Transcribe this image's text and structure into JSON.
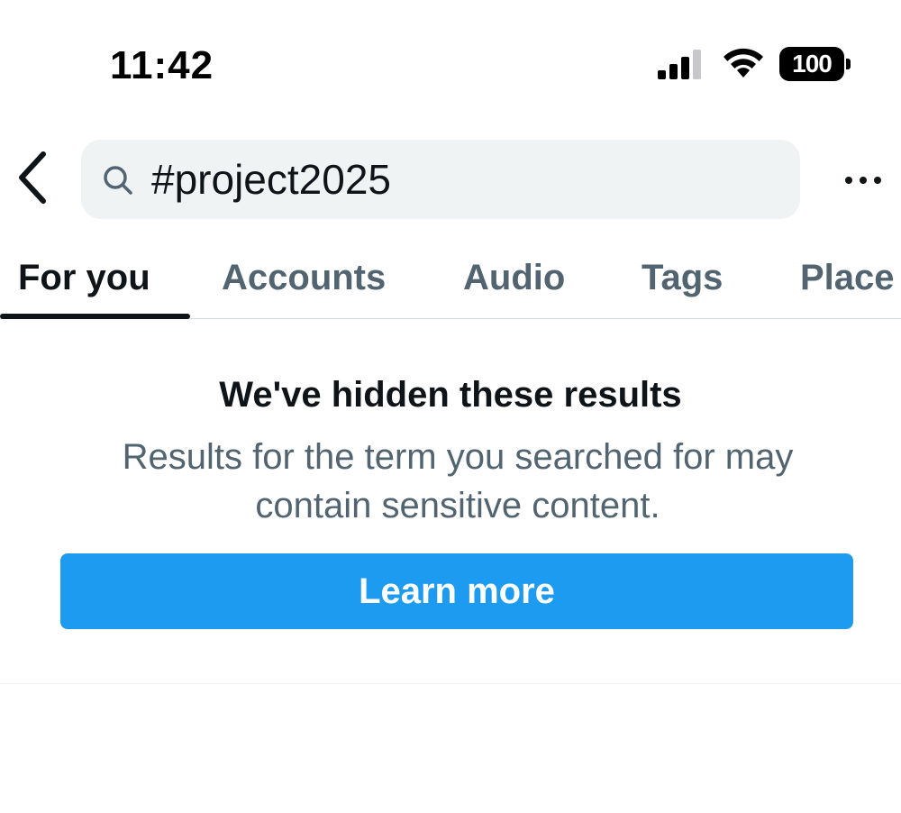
{
  "status_bar": {
    "time": "11:42",
    "battery": "100",
    "signal_icon": "cellular-signal-icon",
    "wifi_icon": "wifi-icon"
  },
  "search": {
    "back_icon": "chevron-left-icon",
    "icon": "search-icon",
    "query": "#project2025",
    "more_icon": "more-horizontal-icon"
  },
  "tabs": [
    {
      "label": "For you",
      "active": true
    },
    {
      "label": "Accounts",
      "active": false
    },
    {
      "label": "Audio",
      "active": false
    },
    {
      "label": "Tags",
      "active": false
    },
    {
      "label": "Place",
      "active": false
    }
  ],
  "notice": {
    "title": "We've hidden these results",
    "body": "Results for the term you searched for may contain sensitive content.",
    "button_label": "Learn more"
  },
  "colors": {
    "accent": "#1d9bf0",
    "text_primary": "#0f1419",
    "text_secondary": "#536471",
    "search_bg": "#eff3f4"
  }
}
